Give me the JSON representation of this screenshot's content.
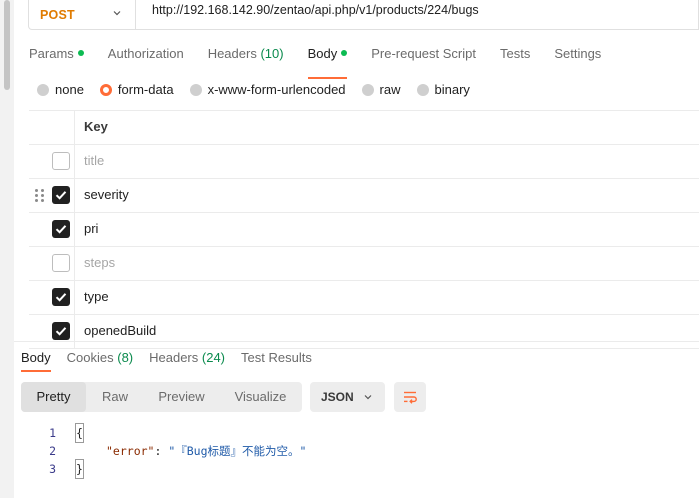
{
  "request": {
    "method": "POST",
    "url": "http://192.168.142.90/zentao/api.php/v1/products/224/bugs"
  },
  "request_tabs": [
    {
      "label": "Params",
      "dot": true
    },
    {
      "label": "Authorization"
    },
    {
      "label": "Headers",
      "count": "(10)"
    },
    {
      "label": "Body",
      "dot": true,
      "active": true
    },
    {
      "label": "Pre-request Script"
    },
    {
      "label": "Tests"
    },
    {
      "label": "Settings"
    }
  ],
  "body_types": [
    "none",
    "form-data",
    "x-www-form-urlencoded",
    "raw",
    "binary"
  ],
  "body_type_selected": "form-data",
  "params_table": {
    "header_key": "Key",
    "rows": [
      {
        "key": "title",
        "checked": false
      },
      {
        "key": "severity",
        "checked": true
      },
      {
        "key": "pri",
        "checked": true
      },
      {
        "key": "steps",
        "checked": false
      },
      {
        "key": "type",
        "checked": true
      },
      {
        "key": "openedBuild",
        "checked": true
      }
    ]
  },
  "response_tabs": [
    {
      "label": "Body",
      "active": true
    },
    {
      "label": "Cookies",
      "count": "(8)"
    },
    {
      "label": "Headers",
      "count": "(24)"
    },
    {
      "label": "Test Results"
    }
  ],
  "view_modes": [
    "Pretty",
    "Raw",
    "Preview",
    "Visualize"
  ],
  "view_mode_selected": "Pretty",
  "format": "JSON",
  "response_body": {
    "line_numbers": [
      "1",
      "2",
      "3"
    ],
    "open_brace": "{",
    "json_key": "\"error\"",
    "json_sep": ": ",
    "json_value": "\"『Bug标题』不能为空。\"",
    "close_brace": "}"
  },
  "colors": {
    "accent": "#ff6c37",
    "method": "#e07b00",
    "count": "#0a8a4d",
    "dot": "#0cbb52"
  }
}
